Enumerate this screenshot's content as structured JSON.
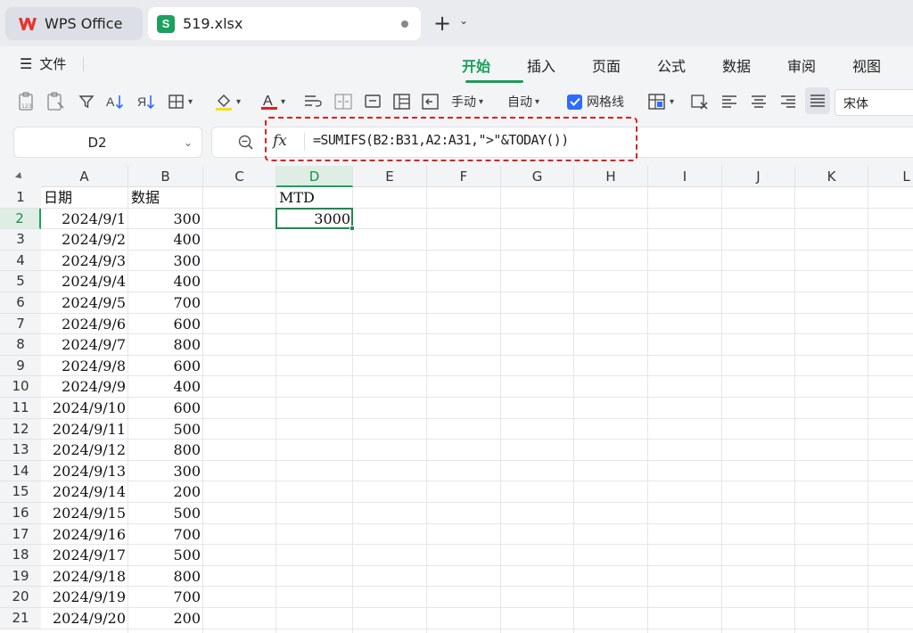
{
  "tabs": {
    "home_label": "WPS Office",
    "file_label": "519.xlsx",
    "file_icon_letter": "S"
  },
  "menu": {
    "file": "文件",
    "items": [
      "开始",
      "插入",
      "页面",
      "公式",
      "数据",
      "审阅",
      "视图"
    ],
    "active_index": 0
  },
  "toolbar": {
    "manual_label": "手动",
    "auto_label": "自动",
    "gridlines_label": "网格线",
    "gridlines_checked": true,
    "font_name": "宋体"
  },
  "formula_bar": {
    "cell_ref": "D2",
    "fx_label": "fx",
    "formula": "=SUMIFS(B2:B31,A2:A31,\">\"&TODAY())"
  },
  "sheet": {
    "columns": [
      "A",
      "B",
      "C",
      "D",
      "E",
      "F",
      "G",
      "H",
      "I",
      "J",
      "K",
      "L"
    ],
    "selected_column": "D",
    "selected_row": 2,
    "row_numbers": [
      "1",
      "2",
      "3",
      "4",
      "5",
      "6",
      "7",
      "8",
      "9",
      "10",
      "11",
      "12",
      "13",
      "14",
      "15",
      "16",
      "17",
      "18",
      "19",
      "20",
      "21"
    ],
    "header": {
      "A1": "日期",
      "B1": "数据",
      "D1": "MTD",
      "D2": "3000"
    },
    "rows": [
      {
        "date": "2024/9/1",
        "value": "300"
      },
      {
        "date": "2024/9/2",
        "value": "400"
      },
      {
        "date": "2024/9/3",
        "value": "300"
      },
      {
        "date": "2024/9/4",
        "value": "400"
      },
      {
        "date": "2024/9/5",
        "value": "700"
      },
      {
        "date": "2024/9/6",
        "value": "600"
      },
      {
        "date": "2024/9/7",
        "value": "800"
      },
      {
        "date": "2024/9/8",
        "value": "600"
      },
      {
        "date": "2024/9/9",
        "value": "400"
      },
      {
        "date": "2024/9/10",
        "value": "600"
      },
      {
        "date": "2024/9/11",
        "value": "500"
      },
      {
        "date": "2024/9/12",
        "value": "800"
      },
      {
        "date": "2024/9/13",
        "value": "300"
      },
      {
        "date": "2024/9/14",
        "value": "200"
      },
      {
        "date": "2024/9/15",
        "value": "500"
      },
      {
        "date": "2024/9/16",
        "value": "700"
      },
      {
        "date": "2024/9/17",
        "value": "500"
      },
      {
        "date": "2024/9/18",
        "value": "800"
      },
      {
        "date": "2024/9/19",
        "value": "700"
      },
      {
        "date": "2024/9/20",
        "value": "200"
      }
    ]
  },
  "colors": {
    "accent_green": "#16a05a",
    "highlight_red": "#e02020",
    "checkbox_blue": "#2f6bff"
  }
}
